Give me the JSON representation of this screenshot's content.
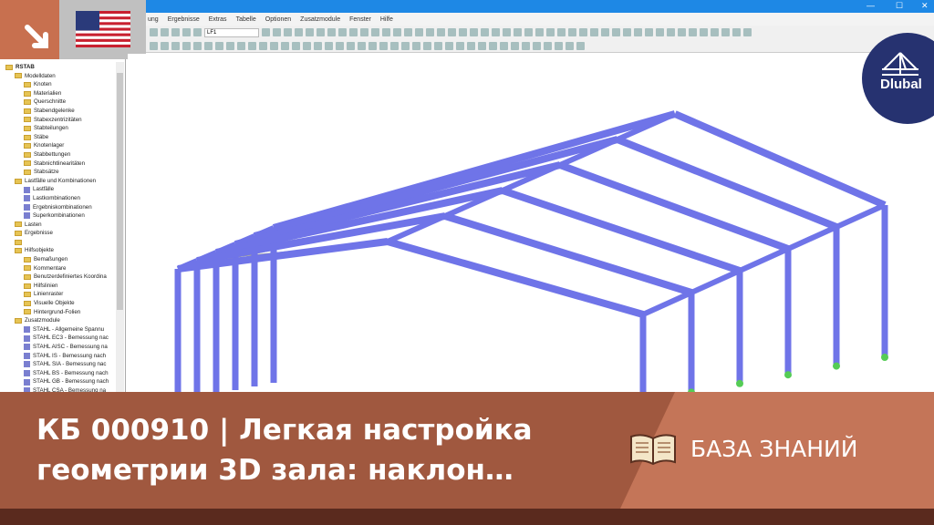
{
  "menu": [
    "ung",
    "Ergebnisse",
    "Extras",
    "Tabelle",
    "Optionen",
    "Zusatzmodule",
    "Fenster",
    "Hilfe"
  ],
  "toolbar": {
    "loadcase": "LF1"
  },
  "tree": [
    {
      "l": 0,
      "t": "RSTAB",
      "k": "root"
    },
    {
      "l": 1,
      "t": "Modelldaten",
      "k": "f"
    },
    {
      "l": 2,
      "t": "Knoten",
      "k": "f"
    },
    {
      "l": 2,
      "t": "Materialien",
      "k": "f"
    },
    {
      "l": 2,
      "t": "Querschnitte",
      "k": "f"
    },
    {
      "l": 2,
      "t": "Stabendgelenke",
      "k": "f"
    },
    {
      "l": 2,
      "t": "Stabexzentrizitäten",
      "k": "f"
    },
    {
      "l": 2,
      "t": "Stabteilungen",
      "k": "f"
    },
    {
      "l": 2,
      "t": "Stäbe",
      "k": "f"
    },
    {
      "l": 2,
      "t": "Knotenlager",
      "k": "f"
    },
    {
      "l": 2,
      "t": "Stabbettungen",
      "k": "f"
    },
    {
      "l": 2,
      "t": "Stabnichtlinearitäten",
      "k": "f"
    },
    {
      "l": 2,
      "t": "Stabsätze",
      "k": "f"
    },
    {
      "l": 1,
      "t": "Lastfälle und Kombinationen",
      "k": "f"
    },
    {
      "l": 2,
      "t": "Lastfälle",
      "k": "m"
    },
    {
      "l": 2,
      "t": "Lastkombinationen",
      "k": "m"
    },
    {
      "l": 2,
      "t": "Ergebniskombinationen",
      "k": "m"
    },
    {
      "l": 2,
      "t": "Superkombinationen",
      "k": "m"
    },
    {
      "l": 1,
      "t": "Lasten",
      "k": "f"
    },
    {
      "l": 1,
      "t": "Ergebnisse",
      "k": "f"
    },
    {
      "l": 1,
      "t": "",
      "k": "f"
    },
    {
      "l": 1,
      "t": "Hilfsobjekte",
      "k": "f"
    },
    {
      "l": 2,
      "t": "Bemaßungen",
      "k": "f"
    },
    {
      "l": 2,
      "t": "Kommentare",
      "k": "f"
    },
    {
      "l": 2,
      "t": "Benutzerdefiniertes Koordina",
      "k": "f"
    },
    {
      "l": 2,
      "t": "Hilfslinien",
      "k": "f"
    },
    {
      "l": 2,
      "t": "Linienraster",
      "k": "f"
    },
    {
      "l": 2,
      "t": "Visuelle Objekte",
      "k": "f"
    },
    {
      "l": 2,
      "t": "Hintergrund-Folien",
      "k": "f"
    },
    {
      "l": 1,
      "t": "Zusatzmodule",
      "k": "f"
    },
    {
      "l": 2,
      "t": "STAHL - Allgemeine Spannu",
      "k": "m"
    },
    {
      "l": 2,
      "t": "STAHL EC3 - Bemessung nac",
      "k": "m"
    },
    {
      "l": 2,
      "t": "STAHL AISC - Bemessung na",
      "k": "m"
    },
    {
      "l": 2,
      "t": "STAHL IS - Bemessung nach",
      "k": "m"
    },
    {
      "l": 2,
      "t": "STAHL SIA - Bemessung nac",
      "k": "m"
    },
    {
      "l": 2,
      "t": "STAHL BS - Bemessung nach",
      "k": "m"
    },
    {
      "l": 2,
      "t": "STAHL GB - Bemessung nach",
      "k": "m"
    },
    {
      "l": 2,
      "t": "STAHL CSA - Bemessung na",
      "k": "m"
    }
  ],
  "logo": "Dlubal",
  "banner": {
    "title": "КБ 000910 | Легкая настройка геометрии 3D зала: наклон…",
    "category": "БАЗА ЗНАНИЙ"
  },
  "colors": {
    "member": "#6f74e8",
    "banner": "#a0583f",
    "accent": "#c47558"
  }
}
